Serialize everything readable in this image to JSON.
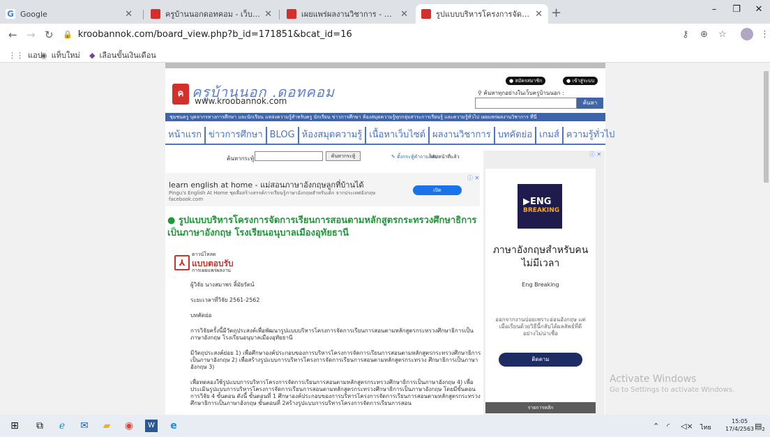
{
  "browser": {
    "tabs": [
      {
        "title": "Google",
        "favicon_color": "#4285f4",
        "favicon_glyph": "G"
      },
      {
        "title": "ครูบ้านนอกดอทคอม - เว็บไซต์เพื่อครู",
        "favicon_color": "#d4302b",
        "favicon_glyph": ""
      },
      {
        "title": "เผยแพร่ผลงานวิชาการ - ครูบ้านนอก",
        "favicon_color": "#d4302b",
        "favicon_glyph": ""
      },
      {
        "title": "รูปแบบบริหารโครงการจัดการเรียนการ",
        "favicon_color": "#d4302b",
        "favicon_glyph": ""
      }
    ],
    "new_tab_glyph": "+",
    "window_controls": {
      "minimize": "–",
      "maximize": "❐",
      "close": "✕"
    },
    "url": "kroobannok.com/board_view.php?b_id=171851&bcat_id=16",
    "bookmarks": [
      {
        "label": "แอป",
        "icon": "apps-grid-icon",
        "glyph": "⋮⋮"
      },
      {
        "label": "แท็บใหม่",
        "icon": "globe-icon",
        "glyph": "◉"
      },
      {
        "label": "เลือนขั้นเงินเดือน",
        "icon": "bookmark-icon",
        "glyph": "◆"
      }
    ]
  },
  "site": {
    "logo_text": "ครูบ้านนอก .ดอทคอม",
    "logo_url": "www.kroobannok.com",
    "register_label": "สมัครสมาชิก",
    "login_label": "เข้าสู่ระบบ",
    "search_hint": "ค้นหาทุกอย่างในเว็บครูบ้านนอก :",
    "search_button": "ค้นหา",
    "tagline": "ชุมชนครู บุคลากรทางการศึกษา และนักเรียน แหล่งความรู้สำหรับครู นักเรียน ข่าวการศึกษา ห้องสมุดความรู้ทุกกลุ่มสาระการเรียนรู้ และความรู้ทั่วไป เผยแพร่ผลงานวิชาการ ที่นี่",
    "nav": [
      "หน้าแรก",
      "ข่าวการศึกษา",
      "BLOG",
      "ห้องสมุดความรู้",
      "เนื้อหาเว็บไซต์",
      "ผลงานวิชาการ",
      "บทคัดย่อ",
      "เกมส์",
      "ความรู้ทั่วไป"
    ],
    "board_search_label": "ค้นหากระทู้",
    "board_search_button": "ค้นหากระทู้",
    "new_question": "ตั้งกระทู้คำถามใหม่",
    "back_home": "กลับหน้าที่แล้ว"
  },
  "ad_banner": {
    "headline": "learn english at home - แม่สอนภาษาอังกฤษลูกที่บ้านได้",
    "subline": "Pingu's English At Home ชุดสื่อสร้างสรรค์การเรียนรู้ภาษาอังกฤษสำหรับเด็ก จากประเทศอังกฤษ",
    "domain": "facebook.com",
    "button": "เปิด",
    "mark": "ⓘ ✕"
  },
  "post": {
    "title": "● รูปแบบบริหารโครงการจัดการเรียนการสอนตามหลักสูตรกระทรวงศึกษาธิการเป็นภาษาอังกฤษ โรงเรียนอนุบาลเมืองอุทัยธานี",
    "download_small": "ดาวน์โหลด",
    "download_big": "แบบตอบรับ",
    "download_sub": "การเผยแพร่ผลงาน",
    "paragraphs": [
      "ผู้วิจัย นางสมาพร ลิ้มัยรัตน์",
      "ระยะเวลาที่วิจัย 2561-2562",
      "บทคัดย่อ",
      "การวิจัยครั้งนี้มีวัตถุประสงค์เพื่อพัฒนารูปแบบบริหารโครงการจัดการเรียนการสอนตามหลักสูตรกระทรวงศึกษาธิการเป็นภาษาอังกฤษ โรงเรียนอนุบาลเมืองอุทัยธานี",
      "มีวัตถุประสงค์ย่อย 1) เพื่อศึกษาองค์ประกอบของการบริหารโครงการจัดการเรียนการสอนตามหลักสูตรกระทรวงศึกษาธิการเป็นภาษาอังกฤษ 2) เพื่อสร้างรูปแบบการบริหารโครงการจัดการเรียนการสอนตามหลักสูตรกระทรวง ศึกษาธิการเป็นภาษาอังกฤษ 3)",
      "เพื่อทดลองใช้รูปแบบการบริหารโครงการจัดการเรียนการสอนตามหลักสูตรกระทรวงศึกษาธิการเป็นภาษาอังกฤษ 4) เพื่อประเมินรูปแบบการบริหารโครงการจัดการเรียนการสอนตามหลักสูตรกระทรวงศึกษาธิการเป็นภาษาอังกฤษ โดยมีขั้นตอนการวิจัย 4 ขั้นตอน ดังนี้ ขั้นตอนที่ 1 ศึกษาองค์ประกอบของการบริหารโครงการจัดการเรียนการสอนตามหลักสูตรกระทรวงศึกษาธิการเป็นภาษาอังกฤษ ขั้นตอนที่ 2สร้างรูปแบบการบริหารโครงการจัดการเรียนการสอน"
    ]
  },
  "side_ad": {
    "mark": "ⓘ ✕",
    "logo_line1": "▶ENG",
    "logo_line2": "BREAKING",
    "headline": "ภาษาอังกฤษสำหรับคนไม่มีเวลา",
    "brand": "Eng Breaking",
    "description": "ออกจากงานบ่อยเพราะอ่อนอังกฤษ แต่เมื่อเรียนด้วยวิธีนี้กลับได้ผลลัพธ์ที่ดี อย่างไม่น่าเชื่อ",
    "button": "ติดตาม",
    "menu_label": "รายการหลัก"
  },
  "watermark": {
    "line1": "Activate Windows",
    "line2": "Go to Settings to activate Windows."
  },
  "taskbar": {
    "time": "15:05",
    "date": "17/4/2563",
    "language": "ไทย",
    "notification_count": "2"
  }
}
